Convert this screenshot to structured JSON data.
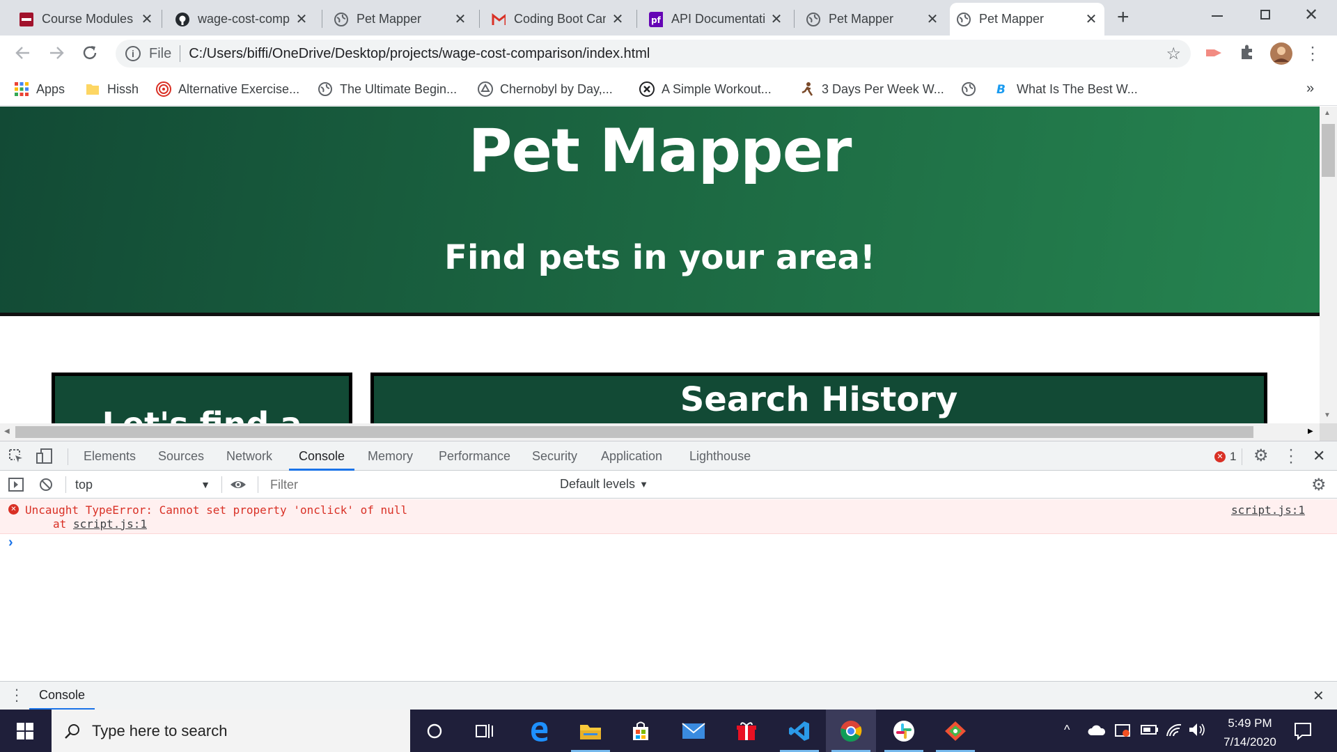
{
  "browser": {
    "tabs": [
      {
        "title": "Course Modules",
        "icon": "canvas-icon",
        "active": false
      },
      {
        "title": "wage-cost-comparison",
        "icon": "github-icon",
        "active": false
      },
      {
        "title": "Pet Mapper",
        "icon": "globe-icon",
        "active": false
      },
      {
        "title": "Coding Boot Camp",
        "icon": "gmail-icon",
        "active": false
      },
      {
        "title": "API Documentation",
        "icon": "petfinder-icon",
        "active": false
      },
      {
        "title": "Pet Mapper",
        "icon": "globe-icon",
        "active": false
      },
      {
        "title": "Pet Mapper",
        "icon": "globe-icon",
        "active": true
      }
    ],
    "address": {
      "scheme_label": "File",
      "url": "C:/Users/biffi/OneDrive/Desktop/projects/wage-cost-comparison/index.html"
    },
    "bookmarks": [
      {
        "label": "Apps",
        "icon": "apps-grid-icon"
      },
      {
        "label": "Hissh",
        "icon": "folder-icon"
      },
      {
        "label": "Alternative Exercise...",
        "icon": "target-icon"
      },
      {
        "label": "The Ultimate Begin...",
        "icon": "globe-icon"
      },
      {
        "label": "Chernobyl by Day,...",
        "icon": "recycle-icon"
      },
      {
        "label": "A Simple Workout...",
        "icon": "circle-x-icon"
      },
      {
        "label": "3 Days Per Week W...",
        "icon": "runner-icon"
      },
      {
        "label": "",
        "icon": "globe-icon"
      },
      {
        "label": "What Is The Best W...",
        "icon": "b-logo-icon"
      }
    ],
    "bookmarks_overflow": "»"
  },
  "page": {
    "title": "Pet Mapper",
    "subtitle": "Find pets in your area!",
    "left_card_title": "Let's find a",
    "search_history_title": "Search History"
  },
  "devtools": {
    "tabs": [
      "Elements",
      "Sources",
      "Network",
      "Console",
      "Memory",
      "Performance",
      "Security",
      "Application",
      "Lighthouse"
    ],
    "active_tab": "Console",
    "error_count": "1",
    "context": "top",
    "filter_placeholder": "Filter",
    "levels": "Default levels",
    "error": {
      "message": "Uncaught TypeError: Cannot set property 'onclick' of null",
      "stack_prefix": "at",
      "stack_link": "script.js:1",
      "source": "script.js:1"
    },
    "prompt": "›",
    "drawer_tab": "Console"
  },
  "taskbar": {
    "search_placeholder": "Type here to search",
    "time": "5:49 PM",
    "date": "7/14/2020"
  },
  "colors": {
    "hero_start": "#124a35",
    "hero_end": "#268450",
    "error_text": "#d93025",
    "error_bg": "#fff0f0",
    "active_tab_underline": "#1a73e8"
  }
}
